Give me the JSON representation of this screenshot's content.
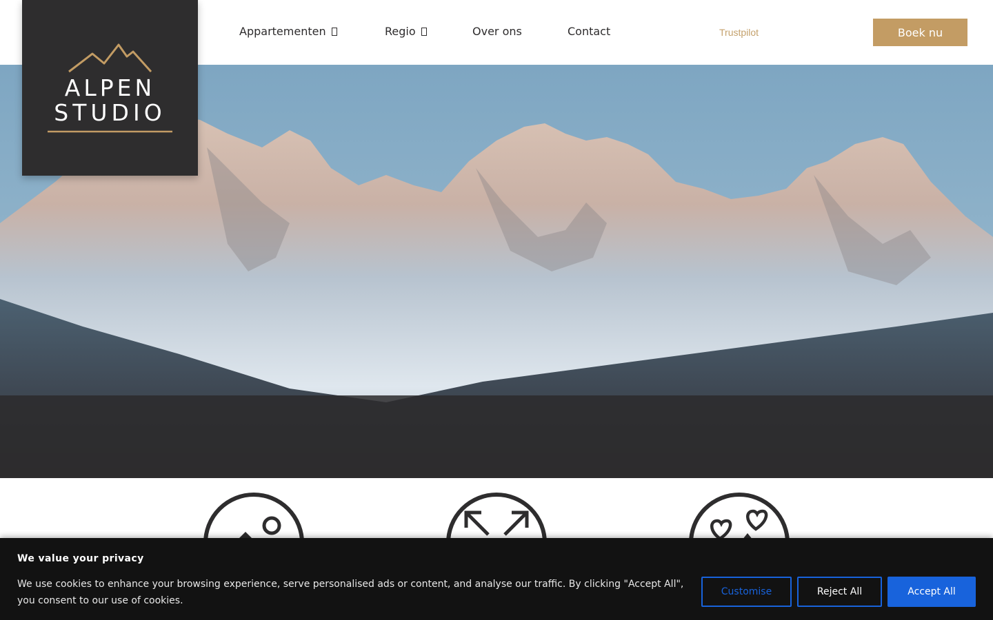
{
  "logo": {
    "line1": "ALPEN",
    "line2": "STUDIO",
    "accent_color": "#c39c64",
    "background_color": "#2e2d2e"
  },
  "nav": {
    "items": [
      {
        "label": "Appartementen",
        "has_dropdown": true
      },
      {
        "label": "Regio",
        "has_dropdown": true
      },
      {
        "label": "Over ons",
        "has_dropdown": false
      },
      {
        "label": "Contact",
        "has_dropdown": false
      }
    ],
    "trustpilot": "Trustpilot",
    "book_label": "Boek nu",
    "book_color": "#c39c64"
  },
  "hero": {
    "image": "snowy-mountain-range-sunrise"
  },
  "features": {
    "icons": [
      "mountain-sun-icon",
      "expand-arrows-icon",
      "hearts-mountain-icon"
    ]
  },
  "cookie_banner": {
    "title": "We value your privacy",
    "text": "We use cookies to enhance your browsing experience, serve personalised ads or content, and analyse our traffic. By clicking \"Accept All\", you consent to our use of cookies.",
    "customise_label": "Customise",
    "reject_label": "Reject All",
    "accept_label": "Accept All",
    "accent_color": "#1863dc"
  }
}
